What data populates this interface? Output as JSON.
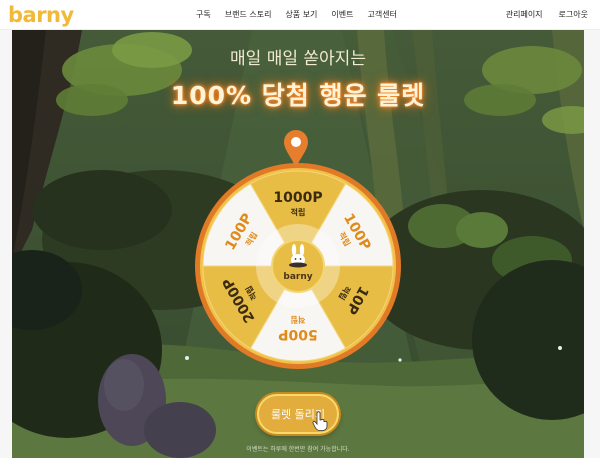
{
  "header": {
    "logo": "barny",
    "nav": [
      "구독",
      "브랜드 스토리",
      "상품 보기",
      "이벤트",
      "고객센터"
    ],
    "util": [
      "관리페이지",
      "로그아웃"
    ]
  },
  "promo": {
    "subtitle": "매일 매일 쏟아지는",
    "title": "100% 당첨 행운 룰렛"
  },
  "wheel": {
    "center_logo": "barny",
    "segments": [
      {
        "amount": "100P",
        "label": "적립"
      },
      {
        "amount": "10P",
        "label": "적립"
      },
      {
        "amount": "500P",
        "label": "적립"
      },
      {
        "amount": "2000P",
        "label": "적립"
      },
      {
        "amount": "100P",
        "label": "적립"
      },
      {
        "amount": "1000P",
        "label": "적립"
      }
    ]
  },
  "spin_button": "룰렛 돌리기",
  "notice": "이벤트는 하루에 한번만 참여 가능합니다.",
  "colors": {
    "brand": "#f0b93a",
    "wheel_rim": "#e07a27",
    "pin": "#e67e2e",
    "button": "#e2ad3c"
  }
}
